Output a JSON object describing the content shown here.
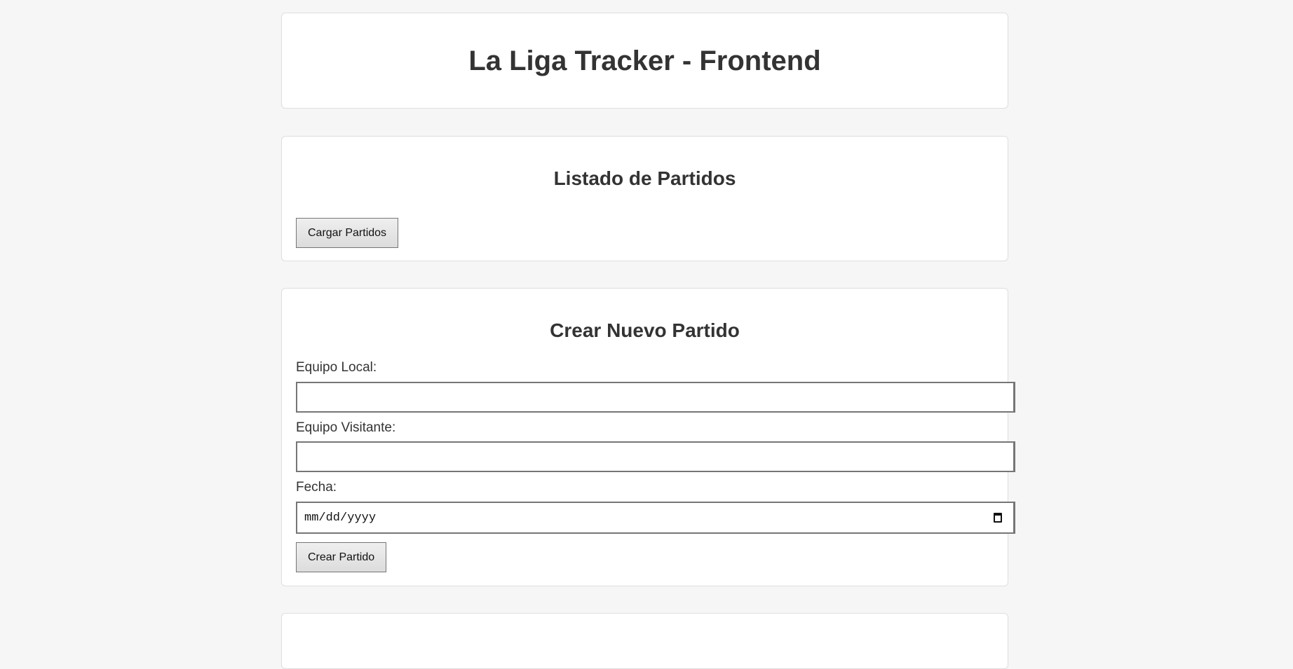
{
  "header": {
    "title": "La Liga Tracker - Frontend"
  },
  "list_section": {
    "title": "Listado de Partidos",
    "load_button": "Cargar Partidos"
  },
  "create_section": {
    "title": "Crear Nuevo Partido",
    "home_label": "Equipo Local:",
    "home_value": "",
    "away_label": "Equipo Visitante:",
    "away_value": "",
    "date_label": "Fecha:",
    "date_placeholder": "mm/dd/yyyy",
    "submit_button": "Crear Partido"
  }
}
